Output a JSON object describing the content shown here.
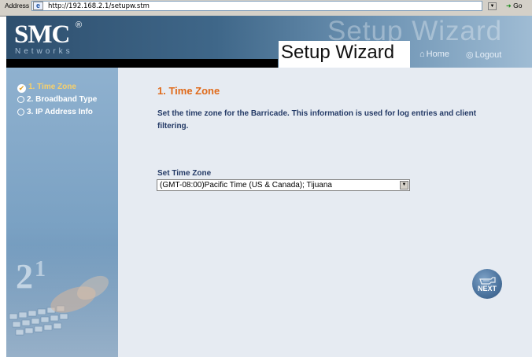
{
  "browser": {
    "address_label": "Address",
    "url": "http://192.168.2.1/setupw.stm",
    "go_label": "Go"
  },
  "header": {
    "logo": "SMC",
    "logo_mark": "®",
    "tagline": "Networks",
    "watermark": "Setup Wizard",
    "title": "Setup Wizard",
    "home_label": "Home",
    "logout_label": "Logout"
  },
  "sidebar": {
    "steps": [
      {
        "label": "1. Time Zone",
        "state": "active"
      },
      {
        "label": "2. Broadband Type",
        "state": "pending"
      },
      {
        "label": "3. IP Address Info",
        "state": "pending"
      }
    ]
  },
  "main": {
    "step_title": "1. Time Zone",
    "description": "Set the time zone for the Barricade. This information is used for log entries and client filtering.",
    "timezone_label": "Set Time Zone",
    "timezone_value": "(GMT-08:00)Pacific Time (US & Canada); Tijuana",
    "next_label": "NEXT"
  },
  "colors": {
    "header_dark": "#2e4f6e",
    "sidebar": "#7aa1c3",
    "main_bg": "#e6ebf2",
    "step_title": "#e06a1a",
    "text": "#243a66",
    "active_step": "#f7d06a"
  }
}
